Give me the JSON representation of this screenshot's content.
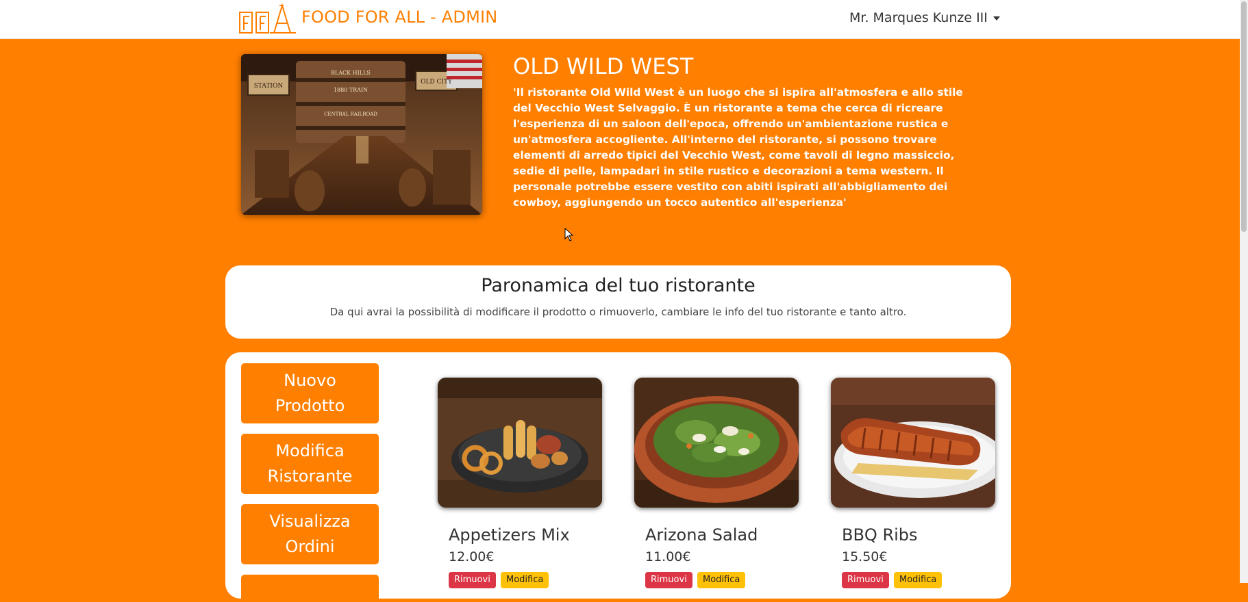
{
  "navbar": {
    "brand": "FOOD FOR ALL - ADMIN",
    "user": "Mr. Marques Kunze III",
    "logo_text": "FFA"
  },
  "restaurant": {
    "name": "OLD WILD WEST",
    "description": "'Il ristorante Old Wild West è un luogo che si ispira all'atmosfera e allo stile del Vecchio West Selvaggio. È un ristorante a tema che cerca di ricreare l'esperienza di un saloon dell'epoca, offrendo un'ambientazione rustica e un'atmosfera accogliente. All'interno del ristorante, si possono trovare elementi di arredo tipici del Vecchio West, come tavoli di legno massiccio, sedie di pelle, lampadari in stile rustico e decorazioni a tema western. Il personale potrebbe essere vestito con abiti ispirati all'abbigliamento dei cowboy, aggiungendo un tocco autentico all'esperienza'",
    "photo_signs": [
      "STATION",
      "BLACK HILLS",
      "1880 TRAIN",
      "CENTRAL RAILROAD",
      "OLD CITY"
    ]
  },
  "overview": {
    "title": "Paronamica del tuo ristorante",
    "subtitle": "Da qui avrai la possibilità di modificare il prodotto o rimuoverlo, cambiare le info del tuo ristorante e tanto altro."
  },
  "sidebar": [
    {
      "label": "Nuovo Prodotto"
    },
    {
      "label": "Modifica Ristorante"
    },
    {
      "label": "Visualizza Ordini"
    }
  ],
  "products": [
    {
      "name": "Appetizers Mix",
      "price": "12.00€",
      "remove": "Rimuovi",
      "edit": "Modifica"
    },
    {
      "name": "Arizona Salad",
      "price": "11.00€",
      "remove": "Rimuovi",
      "edit": "Modifica"
    },
    {
      "name": "BBQ Ribs",
      "price": "15.50€",
      "remove": "Rimuovi",
      "edit": "Modifica"
    }
  ],
  "colors": {
    "accent": "#ff7f00",
    "danger": "#dc3545",
    "warning": "#ffc107",
    "panel": "#ffffff"
  }
}
